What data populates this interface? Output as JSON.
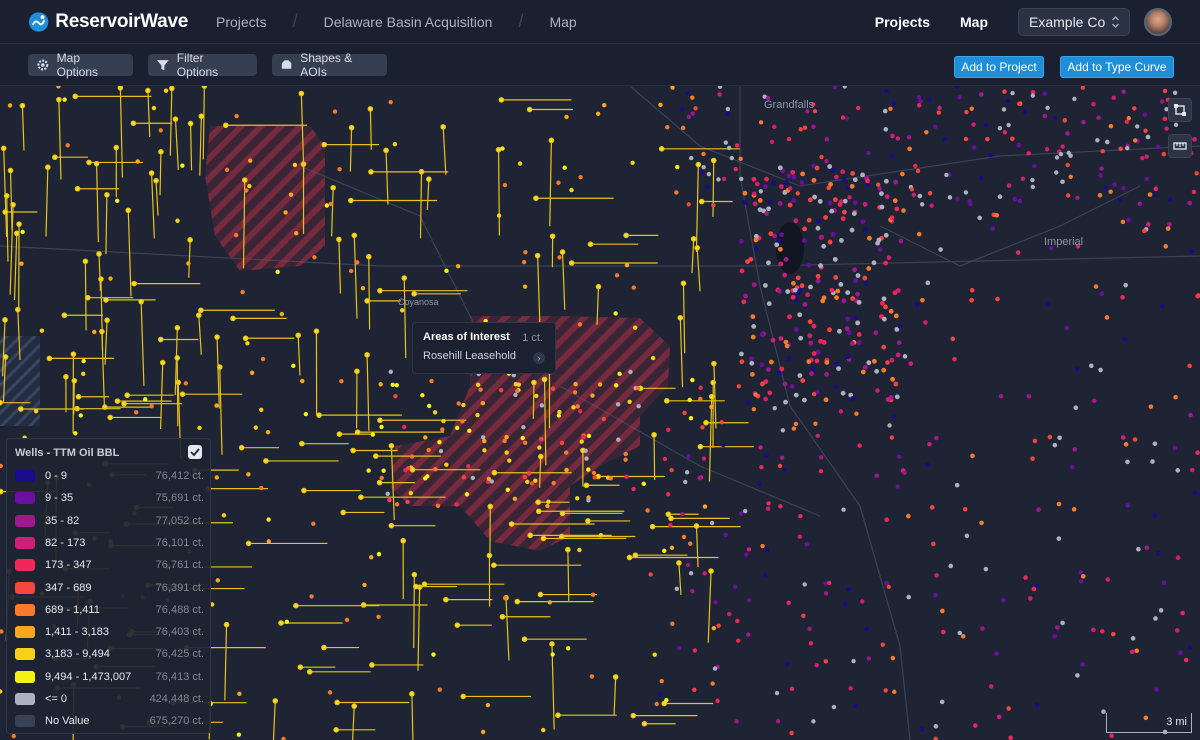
{
  "header": {
    "brand": "ReservoirWave",
    "breadcrumbs": [
      "Projects",
      "Delaware Basin Acquisition",
      "Map"
    ],
    "nav": [
      "Projects",
      "Map"
    ],
    "org": "Example Co"
  },
  "toolbar": {
    "map_options": "Map Options",
    "filter_options": "Filter Options",
    "shapes_aois": "Shapes & AOIs",
    "add_to_project": "Add to Project",
    "add_to_type_curve": "Add to Type Curve"
  },
  "map": {
    "place_labels": [
      "Coyanosa",
      "Grandfalls",
      "Imperial"
    ],
    "tooltip": {
      "title": "Areas of Interest",
      "count": "1 ct.",
      "item": "Rosehill Leasehold"
    },
    "scale": "3 mi"
  },
  "legend": {
    "title": "Wells - TTM Oil BBL",
    "items": [
      {
        "label": "0 - 9",
        "count": "76,412 ct.",
        "color": "#1a0a8c"
      },
      {
        "label": "9 - 35",
        "count": "75,691 ct.",
        "color": "#6a0fa0"
      },
      {
        "label": "35 - 82",
        "count": "77,052 ct.",
        "color": "#a01890"
      },
      {
        "label": "82 - 173",
        "count": "76,101 ct.",
        "color": "#d01e78"
      },
      {
        "label": "173 - 347",
        "count": "76,761 ct.",
        "color": "#f02558"
      },
      {
        "label": "347 - 689",
        "count": "76,391 ct.",
        "color": "#f5453c"
      },
      {
        "label": "689 - 1,411",
        "count": "76,488 ct.",
        "color": "#f87a2a"
      },
      {
        "label": "1,411 - 3,183",
        "count": "76,403 ct.",
        "color": "#f9a81e"
      },
      {
        "label": "3,183 - 9,494",
        "count": "76,425 ct.",
        "color": "#f8d018"
      },
      {
        "label": "9,494 - 1,473,007",
        "count": "76,413 ct.",
        "color": "#f6f216"
      },
      {
        "label": "<= 0",
        "count": "424,448 ct.",
        "color": "#aab1c0"
      },
      {
        "label": "No Value",
        "count": "675,270 ct.",
        "color": "#3a4256"
      }
    ]
  }
}
